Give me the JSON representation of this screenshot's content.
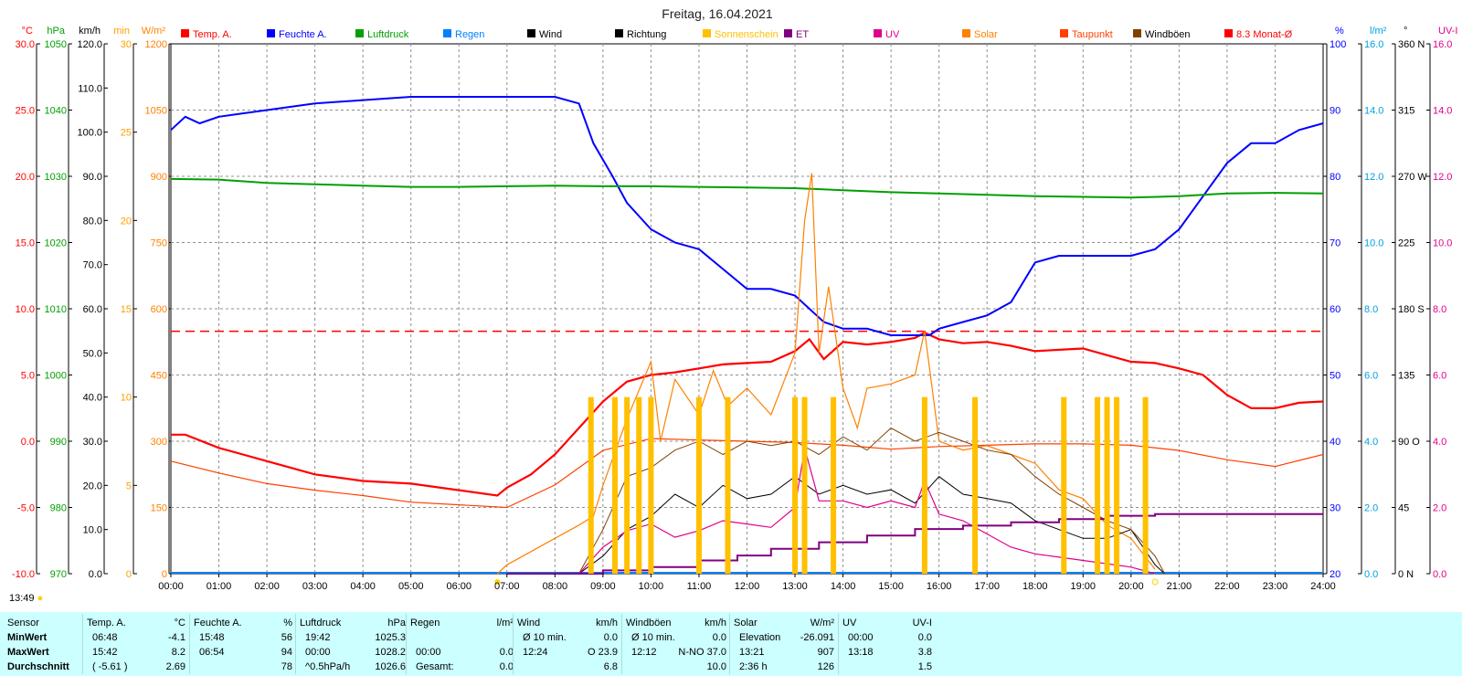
{
  "title": "Freitag, 16.04.2021",
  "current_time": "13:49",
  "colors": {
    "temp": "#ff0000",
    "humidity": "#0000ff",
    "pressure": "#00a000",
    "rain": "#0080ff",
    "wind": "#000000",
    "direction": "#000000",
    "sunshine": "#ffc000",
    "et": "#800080",
    "uv": "#e0008c",
    "solar": "#ff8000",
    "dewpoint": "#ff4000",
    "gusts": "#804000",
    "monthavg": "#ff0000",
    "stats_bg": "#ccffff"
  },
  "axes_left": [
    {
      "unit": "°C",
      "color": "#ff0000",
      "ticks": [
        "30.0",
        "25.0",
        "20.0",
        "15.0",
        "10.0",
        "5.0",
        "0.0",
        "-5.0",
        "-10.0"
      ]
    },
    {
      "unit": "hPa",
      "color": "#00a000",
      "ticks": [
        "1050",
        "1040",
        "1030",
        "1020",
        "1010",
        "1000",
        "990",
        "980",
        "970"
      ]
    },
    {
      "unit": "km/h",
      "color": "#000000",
      "ticks": [
        "120.0",
        "110.0",
        "100.0",
        "90.0",
        "80.0",
        "70.0",
        "60.0",
        "50.0",
        "40.0",
        "30.0",
        "20.0",
        "10.0",
        "0.0"
      ]
    },
    {
      "unit": "min",
      "color": "#ffa000",
      "ticks": [
        "30",
        "25",
        "20",
        "15",
        "10",
        "5",
        "0"
      ]
    },
    {
      "unit": "W/m²",
      "color": "#ff8000",
      "ticks": [
        "1200",
        "1050",
        "900",
        "750",
        "600",
        "450",
        "300",
        "150",
        "0"
      ]
    }
  ],
  "axes_right": [
    {
      "unit": "%",
      "color": "#0000ff",
      "ticks": [
        "100",
        "90",
        "80",
        "70",
        "60",
        "50",
        "40",
        "30",
        "20"
      ]
    },
    {
      "unit": "l/m²",
      "color": "#00a0e0",
      "ticks": [
        "16.0",
        "14.0",
        "12.0",
        "10.0",
        "8.0",
        "6.0",
        "4.0",
        "2.0",
        "0.0"
      ]
    },
    {
      "unit": "°",
      "color": "#000000",
      "ticks": [
        "360 N",
        "315",
        "270 W",
        "225",
        "180 S",
        "135",
        "90 O",
        "45",
        "0 N"
      ]
    },
    {
      "unit": "UV-I",
      "color": "#e0008c",
      "ticks": [
        "16.0",
        "14.0",
        "12.0",
        "10.0",
        "8.0",
        "6.0",
        "4.0",
        "2.0",
        "0.0"
      ]
    }
  ],
  "legend": [
    {
      "label": "Temp. A.",
      "color": "#ff0000",
      "text_color": "#ff0000"
    },
    {
      "label": "Feuchte A.",
      "color": "#0000ff",
      "text_color": "#0000ff"
    },
    {
      "label": "Luftdruck",
      "color": "#00a000",
      "text_color": "#00a000"
    },
    {
      "label": "Regen",
      "color": "#0080ff",
      "text_color": "#0080ff"
    },
    {
      "label": "Wind",
      "color": "#000000",
      "text_color": "#000000"
    },
    {
      "label": "Richtung",
      "color": "#000000",
      "text_color": "#000000"
    },
    {
      "label": "Sonnenschein",
      "color": "#ffc000",
      "text_color": "#ffc000"
    },
    {
      "label": "ET",
      "color": "#800080",
      "text_color": "#800080"
    },
    {
      "label": "UV",
      "color": "#e0008c",
      "text_color": "#e0008c"
    },
    {
      "label": "Solar",
      "color": "#ff8000",
      "text_color": "#ff8000"
    },
    {
      "label": "Taupunkt",
      "color": "#ff4000",
      "text_color": "#ff4000"
    },
    {
      "label": "Windböen",
      "color": "#804000",
      "text_color": "#000000"
    },
    {
      "label": "8.3 Monat-Ø",
      "color": "#ff0000",
      "text_color": "#ff0000"
    }
  ],
  "chart_data": {
    "type": "line",
    "x_ticks": [
      "00:00",
      "01:00",
      "02:00",
      "03:00",
      "04:00",
      "05:00",
      "06:00",
      "07:00",
      "08:00",
      "09:00",
      "10:00",
      "11:00",
      "12:00",
      "13:00",
      "14:00",
      "15:00",
      "16:00",
      "17:00",
      "18:00",
      "19:00",
      "20:00",
      "21:00",
      "22:00",
      "23:00",
      "24:00"
    ],
    "x_range_hours": [
      0,
      24
    ],
    "month_avg_temp": 8.3,
    "series": [
      {
        "name": "Temp. A.",
        "axis": "°C",
        "x": [
          0,
          0.3,
          1,
          1.5,
          2,
          3,
          4,
          5,
          6,
          6.8,
          7,
          7.5,
          8,
          8.5,
          9,
          9.5,
          10,
          10.5,
          11,
          11.5,
          12,
          12.5,
          13,
          13.3,
          13.6,
          14,
          14.5,
          15,
          15.5,
          15.7,
          16,
          16.5,
          17,
          17.5,
          18,
          18.5,
          19,
          19.5,
          20,
          20.5,
          21,
          21.5,
          22,
          22.5,
          23,
          23.5,
          24
        ],
        "y": [
          0.5,
          0.5,
          -0.5,
          -1.0,
          -1.5,
          -2.5,
          -3.0,
          -3.2,
          -3.7,
          -4.1,
          -3.5,
          -2.5,
          -1.0,
          1.0,
          3.0,
          4.5,
          5.0,
          5.2,
          5.5,
          5.8,
          5.9,
          6.0,
          6.8,
          7.7,
          6.2,
          7.5,
          7.3,
          7.5,
          7.8,
          8.2,
          7.7,
          7.4,
          7.5,
          7.2,
          6.8,
          6.9,
          7.0,
          6.5,
          6.0,
          5.9,
          5.5,
          5.0,
          3.5,
          2.5,
          2.5,
          2.9,
          3.0
        ]
      },
      {
        "name": "Feuchte A.",
        "axis": "%",
        "x": [
          0,
          0.3,
          0.6,
          1,
          2,
          3,
          4,
          5,
          6,
          7,
          8,
          8.5,
          8.8,
          9.2,
          9.5,
          10,
          10.5,
          11,
          11.5,
          12,
          12.5,
          13,
          13.3,
          13.6,
          14,
          14.5,
          15,
          15.5,
          15.8,
          16,
          16.5,
          17,
          17.5,
          18,
          18.5,
          19,
          19.5,
          20,
          20.5,
          21,
          21.5,
          22,
          22.5,
          23,
          23.5,
          24
        ],
        "y": [
          87,
          89,
          88,
          89,
          90,
          91,
          91.5,
          92,
          92,
          92,
          92,
          91,
          85,
          80,
          76,
          72,
          70,
          69,
          66,
          63,
          63,
          62,
          60,
          58,
          57,
          57,
          56,
          56,
          56,
          57,
          58,
          59,
          61,
          67,
          68,
          68,
          68,
          68,
          69,
          72,
          77,
          82,
          85,
          85,
          87,
          88
        ]
      },
      {
        "name": "Luftdruck",
        "axis": "hPa",
        "x": [
          0,
          1,
          2,
          3,
          4,
          5,
          6,
          7,
          8,
          9,
          10,
          11,
          12,
          13,
          14,
          15,
          16,
          17,
          18,
          19,
          20,
          21,
          22,
          23,
          24
        ],
        "y": [
          1029.6,
          1029.5,
          1029.0,
          1028.8,
          1028.6,
          1028.4,
          1028.4,
          1028.5,
          1028.6,
          1028.5,
          1028.5,
          1028.4,
          1028.3,
          1028.2,
          1027.9,
          1027.6,
          1027.4,
          1027.2,
          1027.0,
          1026.9,
          1026.8,
          1027.0,
          1027.4,
          1027.5,
          1027.4
        ]
      },
      {
        "name": "Taupunkt",
        "axis": "°C",
        "x": [
          0,
          1,
          2,
          3,
          4,
          5,
          6,
          7,
          8,
          9,
          10,
          11,
          12,
          13,
          14,
          15,
          16,
          17,
          18,
          19,
          20,
          21,
          22,
          23,
          24
        ],
        "y": [
          -1.5,
          -2.4,
          -3.2,
          -3.7,
          -4.1,
          -4.6,
          -4.8,
          -5.0,
          -3.3,
          -0.7,
          0.2,
          0.1,
          0.0,
          -0.1,
          -0.3,
          -0.6,
          -0.4,
          -0.3,
          -0.2,
          -0.2,
          -0.3,
          -0.7,
          -1.4,
          -1.9,
          -1.0
        ]
      },
      {
        "name": "Solar",
        "axis": "W/m²",
        "x": [
          6.8,
          7,
          7.5,
          8,
          8.5,
          8.8,
          9,
          9.5,
          10,
          10.2,
          10.5,
          11,
          11.3,
          11.6,
          12,
          12.5,
          13,
          13.2,
          13.35,
          13.5,
          13.7,
          14,
          14.3,
          14.5,
          15,
          15.5,
          15.7,
          16,
          16.5,
          17,
          17.5,
          18,
          18.5,
          19,
          19.5,
          20,
          20.5
        ],
        "y": [
          0,
          20,
          50,
          80,
          110,
          130,
          200,
          350,
          480,
          300,
          440,
          360,
          460,
          380,
          420,
          360,
          500,
          800,
          907,
          500,
          650,
          420,
          330,
          420,
          430,
          450,
          550,
          300,
          280,
          290,
          270,
          250,
          190,
          170,
          110,
          80,
          10
        ]
      },
      {
        "name": "Wind",
        "axis": "km/h",
        "x": [
          8.5,
          9,
          9.5,
          10,
          10.5,
          11,
          11.5,
          12,
          12.5,
          13,
          13.5,
          14,
          14.5,
          15,
          15.5,
          16,
          16.5,
          17,
          17.5,
          18,
          18.5,
          19,
          19.5,
          20,
          20.5,
          20.7
        ],
        "y": [
          0,
          4,
          10,
          13,
          18,
          15,
          20,
          17,
          18,
          22,
          18,
          20,
          18,
          19,
          16,
          22,
          18,
          17,
          16,
          12,
          10,
          8,
          8,
          10,
          2,
          0
        ]
      },
      {
        "name": "Windböen",
        "axis": "km/h",
        "x": [
          8.5,
          9,
          9.5,
          10,
          10.5,
          11,
          11.5,
          12,
          12.5,
          13,
          13.5,
          14,
          14.5,
          15,
          15.5,
          16,
          16.5,
          17,
          17.5,
          18,
          18.5,
          19,
          19.5,
          20,
          20.5,
          20.7
        ],
        "y": [
          0,
          10,
          22,
          24,
          28,
          30,
          27,
          30,
          29,
          30,
          27,
          31,
          28,
          33,
          30,
          32,
          30,
          28,
          27,
          22,
          18,
          15,
          12,
          10,
          4,
          0
        ]
      },
      {
        "name": "UV",
        "axis": "UV-I",
        "x": [
          8.5,
          9,
          9.5,
          10,
          10.5,
          11,
          11.5,
          12,
          12.5,
          13,
          13.2,
          13.5,
          14,
          14.5,
          15,
          15.5,
          15.7,
          16,
          16.5,
          17,
          17.5,
          18,
          18.5,
          19,
          19.5,
          20,
          20.5
        ],
        "y": [
          0,
          0.8,
          1.3,
          1.5,
          1.1,
          1.3,
          1.6,
          1.5,
          1.4,
          2.0,
          3.8,
          2.2,
          2.2,
          2.0,
          2.2,
          2.0,
          2.8,
          1.8,
          1.6,
          1.2,
          0.8,
          0.6,
          0.5,
          0.4,
          0.3,
          0.2,
          0
        ]
      },
      {
        "name": "ET",
        "axis": "l/m²",
        "x": [
          7,
          9,
          10,
          11,
          11.8,
          12.5,
          13.5,
          14.5,
          15.5,
          16.5,
          17.5,
          18.5,
          19.5,
          20.5,
          22,
          24
        ],
        "y": [
          0,
          0.1,
          0.2,
          0.4,
          0.55,
          0.75,
          0.95,
          1.15,
          1.35,
          1.45,
          1.55,
          1.65,
          1.75,
          1.8,
          1.8,
          1.8
        ]
      },
      {
        "name": "Sonnenschein",
        "axis": "min",
        "x": [
          8.75,
          9.25,
          9.5,
          9.75,
          10,
          11,
          11.6,
          13,
          13.2,
          13.8,
          15.7,
          16.75,
          18.6,
          19.3,
          19.5,
          19.7,
          20.3
        ],
        "y": [
          10,
          10,
          10,
          10,
          10,
          10,
          10,
          10,
          10,
          10,
          10,
          10,
          10,
          10,
          10,
          10,
          10
        ]
      }
    ]
  },
  "stats": {
    "row_labels": {
      "header": "Sensor",
      "min": "MinWert",
      "max": "MaxWert",
      "avg": "Durchschnitt"
    },
    "columns": [
      {
        "header": "Temp. A.",
        "unit": "°C",
        "min_time": "06:48",
        "min_val": "-4.1",
        "max_time": "15:42",
        "max_val": "8.2",
        "avg_note": "( -5.61 )",
        "avg_val": "2.69"
      },
      {
        "header": "Feuchte A.",
        "unit": "%",
        "min_time": "15:48",
        "min_val": "56",
        "max_time": "06:54",
        "max_val": "94",
        "avg_note": "",
        "avg_val": "78"
      },
      {
        "header": "Luftdruck",
        "unit": "hPa",
        "min_time": "19:42",
        "min_val": "1025.3",
        "max_time": "00:00",
        "max_val": "1028.2",
        "avg_note": "^0.5hPa/h",
        "avg_val": "1026.6"
      },
      {
        "header": "Regen",
        "unit": "l/m²",
        "min_time": "",
        "min_val": "",
        "max_time": "00:00",
        "max_val": "0.0",
        "avg_note": "Gesamt:",
        "avg_val": "0.0"
      },
      {
        "header": "Wind",
        "unit": "km/h",
        "min_time": "Ø 10 min.",
        "min_val": "0.0",
        "max_time": "12:24",
        "max_val": "O 23.9",
        "avg_note": "",
        "avg_val": "6.8"
      },
      {
        "header": "Windböen",
        "unit": "km/h",
        "min_time": "Ø 10 min.",
        "min_val": "0.0",
        "max_time": "12:12",
        "max_val": "N-NO 37.0",
        "avg_note": "",
        "avg_val": "10.0"
      },
      {
        "header": "Solar",
        "unit": "W/m²",
        "min_time": "Elevation",
        "min_val": "-26.091",
        "max_time": "13:21",
        "max_val": "907",
        "avg_note": "2:36 h",
        "avg_val": "126"
      },
      {
        "header": "UV",
        "unit": "UV-I",
        "min_time": "00:00",
        "min_val": "0.0",
        "max_time": "13:18",
        "max_val": "3.8",
        "avg_note": "",
        "avg_val": "1.5"
      }
    ]
  }
}
